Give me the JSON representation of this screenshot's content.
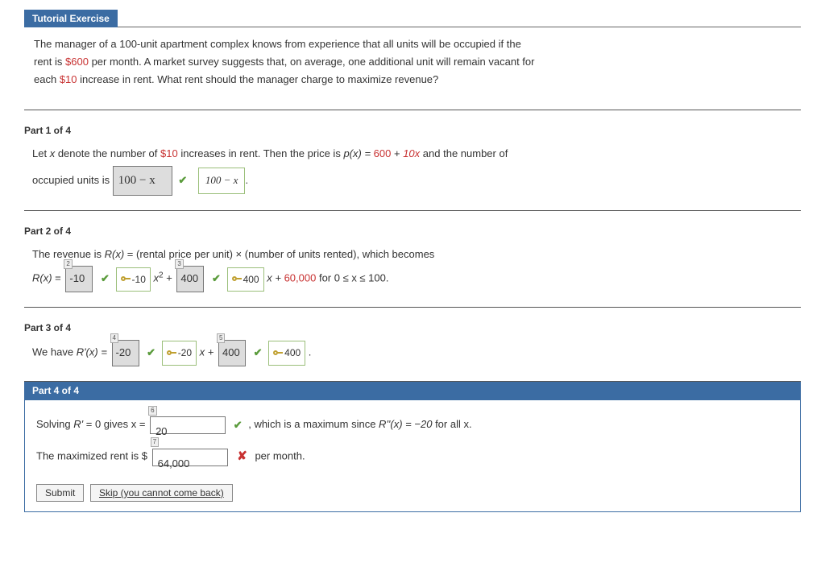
{
  "header": {
    "title": "Tutorial Exercise"
  },
  "problem": {
    "line1a": "The manager of a 100-unit apartment complex knows from experience that all units will be occupied if the",
    "line2a": "rent is ",
    "rent": "$600",
    "line2b": " per month. A market survey suggests that, on average, one additional unit will remain vacant for",
    "line3a": "each ",
    "inc": "$10",
    "line3b": " increase in rent. What rent should the manager charge to maximize revenue?"
  },
  "part1": {
    "label": "Part 1 of 4",
    "t1": "Let ",
    "t2": " denote the number of ",
    "d10": "$10",
    "t3": " increases in rent. Then the price is  ",
    "px": "p(x) = ",
    "c600": "600",
    "plus": " + ",
    "c10x": "10x",
    "t4": "  and the number of",
    "t5": "occupied units is ",
    "ans": "100 − x",
    "fb": "100 − x"
  },
  "part2": {
    "label": "Part 2 of 4",
    "t1": "The revenue is ",
    "rx": "R(x)",
    "t2": " = (rental price per unit) × (number of units rented), which becomes",
    "eq1": " = ",
    "tag2": "2",
    "v2": "-10",
    "k2": "-10",
    "xsq": " x",
    "sq": "2",
    "plus": " + ",
    "tag3": "3",
    "v3": "400",
    "k3": "400",
    "xplus": " x + ",
    "c60k": "60,000",
    "dom": "  for  0 ≤ x ≤ 100."
  },
  "part3": {
    "label": "Part 3 of 4",
    "t1": "We have  ",
    "rpx": "R'(x) = ",
    "tag4": "4",
    "v4": "-20",
    "k4": "-20",
    "xplus": " x + ",
    "tag5": "5",
    "v5": "400",
    "k5": "400",
    "dot": "  ."
  },
  "part4": {
    "label": "Part 4 of 4",
    "l1a": "Solving ",
    "rp": "R' ",
    "l1b": "= 0 gives x = ",
    "tag6": "6",
    "v6": "20",
    "l1c": " ,  which is a maximum since  ",
    "rpp": "R''(x) = −20",
    "l1d": "  for all x.",
    "l2a": "The maximized rent is $ ",
    "tag7": "7",
    "v7": "64,000",
    "l2b": "  per month.",
    "submit": "Submit",
    "skip": "Skip (you cannot come back)"
  }
}
